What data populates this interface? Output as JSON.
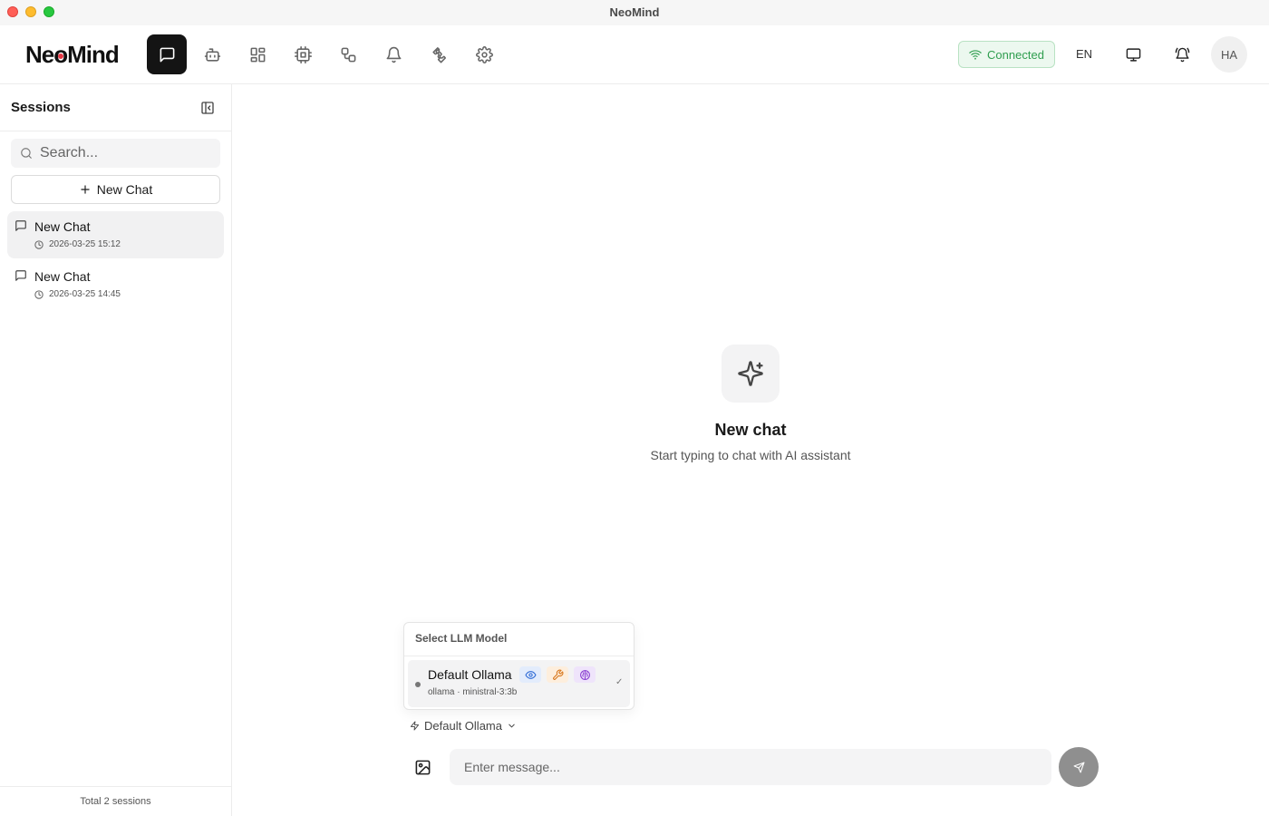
{
  "window": {
    "title": "NeoMind"
  },
  "header": {
    "logo_text": "NeoMind",
    "nav_items": [
      {
        "name": "chat",
        "icon": "message-square-icon",
        "active": true
      },
      {
        "name": "agents",
        "icon": "bot-icon"
      },
      {
        "name": "dashboard",
        "icon": "layout-grid-icon"
      },
      {
        "name": "devices",
        "icon": "cpu-icon"
      },
      {
        "name": "automation",
        "icon": "workflow-icon"
      },
      {
        "name": "alerts",
        "icon": "bell-icon"
      },
      {
        "name": "extensions",
        "icon": "puzzle-icon"
      },
      {
        "name": "settings",
        "icon": "gear-icon"
      }
    ],
    "status": "Connected",
    "status_color": "#2f9e4f",
    "language": "EN",
    "avatar_initials": "HA"
  },
  "sidebar": {
    "title": "Sessions",
    "search_placeholder": "Search...",
    "new_chat_label": "New Chat",
    "sessions": [
      {
        "title": "New Chat",
        "time": "2026-03-25 15:12",
        "active": true
      },
      {
        "title": "New Chat",
        "time": "2026-03-25 14:45",
        "active": false
      }
    ],
    "footer": "Total 2 sessions"
  },
  "main": {
    "empty_title": "New chat",
    "empty_subtitle": "Start typing to chat with AI assistant",
    "model_popup": {
      "header": "Select LLM Model",
      "models": [
        {
          "name": "Default Ollama",
          "meta": "ollama · ministral-3:3b",
          "selected": true,
          "check": "✓",
          "capabilities": [
            "eye-icon",
            "wrench-icon",
            "brain-icon"
          ]
        }
      ]
    },
    "model_selector_label": "Default Ollama",
    "input_placeholder": "Enter message..."
  }
}
